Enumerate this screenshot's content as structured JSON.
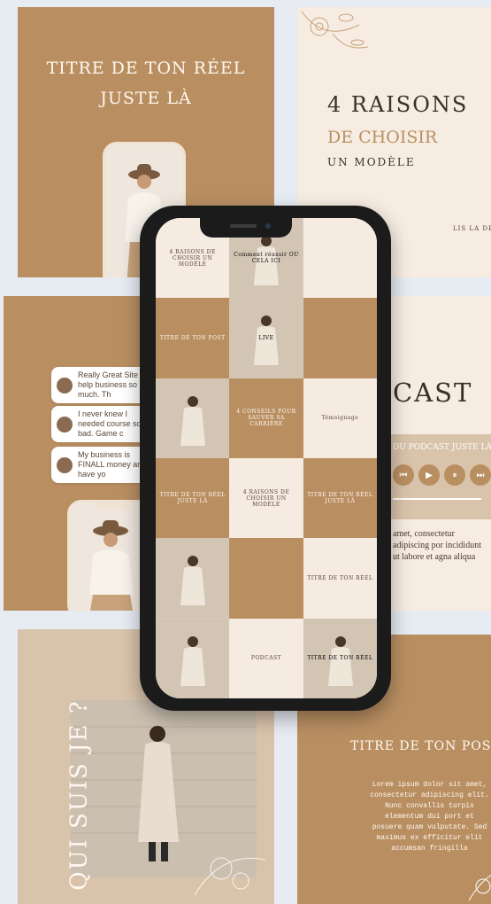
{
  "tiles": {
    "tile_top_left": {
      "title_line1": "TITRE DE TON RÉEL",
      "title_line2": "JUSTE LÀ"
    },
    "tile_top_right": {
      "line1": "4 RAISONS",
      "line2": "DE CHOISIR",
      "line3": "UN MODÈLE",
      "corner": "LIS LA DE"
    },
    "tile_mid_left": {
      "bubbles": [
        {
          "text": "Really Great Site help business so much. Th"
        },
        {
          "text": "I never knew I needed course so bad. Game c"
        },
        {
          "text": "My business is FINALL money and I have yo"
        }
      ]
    },
    "tile_mid_right": {
      "title": "CAST",
      "subtitle": "DU PODCAST JUSTE LÀ",
      "controls": [
        "⏮",
        "▶",
        "⏸",
        "⏭"
      ],
      "body": "amet, consectetur adipiscing por incididunt ut labore et agna aliqua"
    },
    "tile_bottom_left": {
      "vertical_title": "QUI SUIS JE ?"
    },
    "tile_bottom_right": {
      "title": "TITRE DE TON POST",
      "body": "Lorem ipsum dolor sit amet, consectetur adipiscing elit. Nunc convallis turpis elementum dui port et posuere quam vulputate. Sed maximus ex efficitur elit accumsan fringilla"
    }
  },
  "phone_grid": {
    "cells": [
      {
        "text": "4 RAISONS DE CHOISIR UN MODÈLE",
        "style": "cream"
      },
      {
        "text": "Comment réussir OU CELA ICI",
        "style": "photo"
      },
      {
        "text": "",
        "style": "cream"
      },
      {
        "text": "TITRE DE TON POST",
        "style": "tan"
      },
      {
        "text": "LIVE",
        "style": "photo"
      },
      {
        "text": "",
        "style": "tan"
      },
      {
        "text": "",
        "style": "photo"
      },
      {
        "text": "4 CONSEILS POUR SAUVER SA CARRIÈRE",
        "style": "tan"
      },
      {
        "text": "Témoignage",
        "style": "cream"
      },
      {
        "text": "TITRE DE TON RÉEL JUSTE LÀ",
        "style": "tan"
      },
      {
        "text": "4 RAISONS DE CHOISIR UN MODÈLE",
        "style": "cream"
      },
      {
        "text": "TITRE DE TON RÉEL JUSTE LÀ",
        "style": "tan"
      },
      {
        "text": "",
        "style": "photo"
      },
      {
        "text": "",
        "style": "tan"
      },
      {
        "text": "TITRE DE TON RÉEL",
        "style": "cream"
      },
      {
        "text": "",
        "style": "photo"
      },
      {
        "text": "PODCAST",
        "style": "cream"
      },
      {
        "text": "TITRE DE TON RÉEL",
        "style": "photo"
      }
    ]
  }
}
